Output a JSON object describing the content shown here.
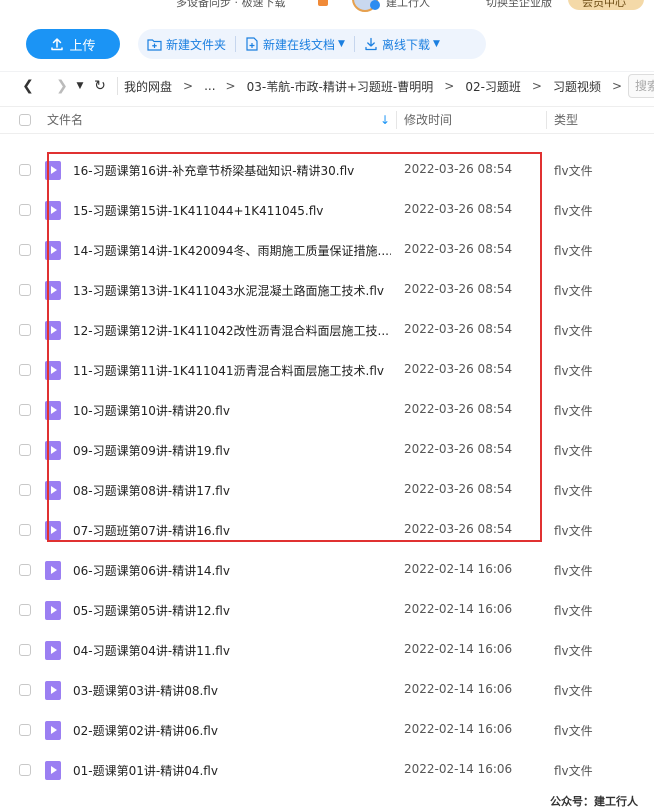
{
  "topbar": {
    "left_text": "多设备同步 · 极速下载",
    "user_text": "建工行人",
    "enterprise_text": "切换至企业版",
    "pill_text": "会员中心"
  },
  "toolbar": {
    "upload_label": "上传",
    "new_folder_label": "新建文件夹",
    "new_online_doc_label": "新建在线文档",
    "offline_download_label": "离线下载",
    "accent_color": "#1b94f5"
  },
  "breadcrumb": {
    "items": [
      "我的网盘",
      "...",
      "03-苇航-市政-精讲+习题班-曹明明",
      "02-习题班",
      "习题视频"
    ],
    "search_placeholder": "搜索"
  },
  "table": {
    "headers": {
      "name": "文件名",
      "modified": "修改时间",
      "type": "类型"
    },
    "rows": [
      {
        "name": "16-习题课第16讲-补充章节桥梁基础知识-精讲30.flv",
        "modified": "2022-03-26 08:54",
        "type": "flv文件"
      },
      {
        "name": "15-习题课第15讲-1K411044+1K411045.flv",
        "modified": "2022-03-26 08:54",
        "type": "flv文件"
      },
      {
        "name": "14-习题课第14讲-1K420094冬、雨期施工质量保证措施....",
        "modified": "2022-03-26 08:54",
        "type": "flv文件"
      },
      {
        "name": "13-习题课第13讲-1K411043水泥混凝土路面施工技术.flv",
        "modified": "2022-03-26 08:54",
        "type": "flv文件"
      },
      {
        "name": "12-习题课第12讲-1K411042改性沥青混合料面层施工技...",
        "modified": "2022-03-26 08:54",
        "type": "flv文件"
      },
      {
        "name": "11-习题课第11讲-1K411041沥青混合料面层施工技术.flv",
        "modified": "2022-03-26 08:54",
        "type": "flv文件"
      },
      {
        "name": "10-习题课第10讲-精讲20.flv",
        "modified": "2022-03-26 08:54",
        "type": "flv文件"
      },
      {
        "name": "09-习题课第09讲-精讲19.flv",
        "modified": "2022-03-26 08:54",
        "type": "flv文件"
      },
      {
        "name": "08-习题课第08讲-精讲17.flv",
        "modified": "2022-03-26 08:54",
        "type": "flv文件"
      },
      {
        "name": "07-习题班第07讲-精讲16.flv",
        "modified": "2022-03-26 08:54",
        "type": "flv文件"
      },
      {
        "name": "06-习题课第06讲-精讲14.flv",
        "modified": "2022-02-14 16:06",
        "type": "flv文件"
      },
      {
        "name": "05-习题课第05讲-精讲12.flv",
        "modified": "2022-02-14 16:06",
        "type": "flv文件"
      },
      {
        "name": "04-习题课第04讲-精讲11.flv",
        "modified": "2022-02-14 16:06",
        "type": "flv文件"
      },
      {
        "name": "03-题课第03讲-精讲08.flv",
        "modified": "2022-02-14 16:06",
        "type": "flv文件"
      },
      {
        "name": "02-题课第02讲-精讲06.flv",
        "modified": "2022-02-14 16:06",
        "type": "flv文件"
      },
      {
        "name": "01-题课第01讲-精讲04.flv",
        "modified": "2022-02-14 16:06",
        "type": "flv文件"
      }
    ]
  },
  "watermark": "公众号：建工行人",
  "highlight_color": "#e03131"
}
